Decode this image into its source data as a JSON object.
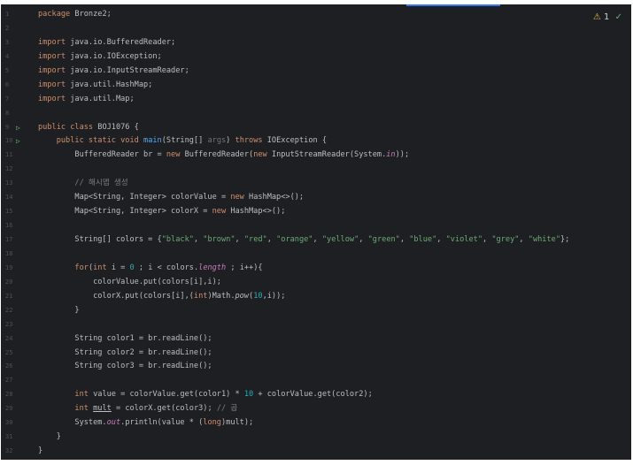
{
  "editor": {
    "status": {
      "warning_icon": "⚠",
      "warning_count": "1",
      "check_icon": "✓"
    },
    "lines": [
      {
        "n": "1",
        "t": [
          [
            "kw",
            "package "
          ],
          [
            "p",
            "Bronze2;"
          ]
        ]
      },
      {
        "n": "2",
        "t": []
      },
      {
        "n": "3",
        "t": [
          [
            "kw",
            "import "
          ],
          [
            "p",
            "java.io.BufferedReader;"
          ]
        ]
      },
      {
        "n": "4",
        "t": [
          [
            "kw",
            "import "
          ],
          [
            "p",
            "java.io.IOException;"
          ]
        ]
      },
      {
        "n": "5",
        "t": [
          [
            "kw",
            "import "
          ],
          [
            "p",
            "java.io.InputStreamReader;"
          ]
        ]
      },
      {
        "n": "6",
        "t": [
          [
            "kw",
            "import "
          ],
          [
            "p",
            "java.util.HashMap;"
          ]
        ]
      },
      {
        "n": "7",
        "t": [
          [
            "kw",
            "import "
          ],
          [
            "p",
            "java.util.Map;"
          ]
        ]
      },
      {
        "n": "8",
        "t": []
      },
      {
        "n": "9",
        "run": true,
        "t": [
          [
            "kw",
            "public class "
          ],
          [
            "p",
            "BOJ1076 {"
          ]
        ]
      },
      {
        "n": "10",
        "run": true,
        "t": [
          [
            "p",
            "    "
          ],
          [
            "kw",
            "public static void "
          ],
          [
            "fn",
            "main"
          ],
          [
            "p",
            "(String[] "
          ],
          [
            "par",
            "args"
          ],
          [
            "p",
            ") "
          ],
          [
            "kw",
            "throws "
          ],
          [
            "p",
            "IOException {"
          ]
        ]
      },
      {
        "n": "11",
        "t": [
          [
            "p",
            "        BufferedReader br = "
          ],
          [
            "kw",
            "new "
          ],
          [
            "p",
            "BufferedReader("
          ],
          [
            "kw",
            "new "
          ],
          [
            "p",
            "InputStreamReader(System."
          ],
          [
            "fldi",
            "in"
          ],
          [
            "p",
            "));"
          ]
        ]
      },
      {
        "n": "12",
        "t": []
      },
      {
        "n": "13",
        "t": [
          [
            "p",
            "        "
          ],
          [
            "cmt",
            "// 해시맵 생성"
          ]
        ]
      },
      {
        "n": "14",
        "t": [
          [
            "p",
            "        Map<String, Integer> colorValue = "
          ],
          [
            "kw",
            "new "
          ],
          [
            "p",
            "HashMap<>();"
          ]
        ]
      },
      {
        "n": "15",
        "t": [
          [
            "p",
            "        Map<String, Integer> colorX = "
          ],
          [
            "kw",
            "new "
          ],
          [
            "p",
            "HashMap<>();"
          ]
        ]
      },
      {
        "n": "16",
        "t": []
      },
      {
        "n": "17",
        "t": [
          [
            "p",
            "        String[] colors = {"
          ],
          [
            "str",
            "\"black\""
          ],
          [
            "p",
            ", "
          ],
          [
            "str",
            "\"brown\""
          ],
          [
            "p",
            ", "
          ],
          [
            "str",
            "\"red\""
          ],
          [
            "p",
            ", "
          ],
          [
            "str",
            "\"orange\""
          ],
          [
            "p",
            ", "
          ],
          [
            "str",
            "\"yellow\""
          ],
          [
            "p",
            ", "
          ],
          [
            "str",
            "\"green\""
          ],
          [
            "p",
            ", "
          ],
          [
            "str",
            "\"blue\""
          ],
          [
            "p",
            ", "
          ],
          [
            "str",
            "\"violet\""
          ],
          [
            "p",
            ", "
          ],
          [
            "str",
            "\"grey\""
          ],
          [
            "p",
            ", "
          ],
          [
            "str",
            "\"white\""
          ],
          [
            "p",
            "};"
          ]
        ]
      },
      {
        "n": "18",
        "t": []
      },
      {
        "n": "19",
        "t": [
          [
            "p",
            "        "
          ],
          [
            "kw",
            "for"
          ],
          [
            "p",
            "("
          ],
          [
            "kw",
            "int "
          ],
          [
            "p",
            "i = "
          ],
          [
            "num",
            "0"
          ],
          [
            "p",
            " ; i < colors."
          ],
          [
            "fld",
            "length"
          ],
          [
            "p",
            " ; i++){"
          ]
        ]
      },
      {
        "n": "20",
        "t": [
          [
            "p",
            "            colorValue.put(colors[i],i);"
          ]
        ]
      },
      {
        "n": "21",
        "t": [
          [
            "p",
            "            colorX.put(colors[i],("
          ],
          [
            "kw",
            "int"
          ],
          [
            "p",
            ")Math."
          ],
          [
            "i",
            "pow"
          ],
          [
            "p",
            "("
          ],
          [
            "num",
            "10"
          ],
          [
            "p",
            ",i));"
          ]
        ]
      },
      {
        "n": "22",
        "t": [
          [
            "p",
            "        }"
          ]
        ]
      },
      {
        "n": "23",
        "t": []
      },
      {
        "n": "24",
        "t": [
          [
            "p",
            "        String color1 = br.readLine();"
          ]
        ]
      },
      {
        "n": "25",
        "t": [
          [
            "p",
            "        String color2 = br.readLine();"
          ]
        ]
      },
      {
        "n": "26",
        "t": [
          [
            "p",
            "        String color3 = br.readLine();"
          ]
        ]
      },
      {
        "n": "27",
        "t": []
      },
      {
        "n": "28",
        "t": [
          [
            "p",
            "        "
          ],
          [
            "kw",
            "int "
          ],
          [
            "p",
            "value = colorValue.get(color1) * "
          ],
          [
            "num",
            "10"
          ],
          [
            "p",
            " + colorValue.get(color2);"
          ]
        ]
      },
      {
        "n": "29",
        "t": [
          [
            "p",
            "        "
          ],
          [
            "kw",
            "int "
          ],
          [
            "ul",
            "mult"
          ],
          [
            "p",
            " = colorX.get(color3); "
          ],
          [
            "cmt",
            "// 곱"
          ]
        ]
      },
      {
        "n": "30",
        "t": [
          [
            "p",
            "        System."
          ],
          [
            "fldi",
            "out"
          ],
          [
            "p",
            ".println(value * ("
          ],
          [
            "kw",
            "long"
          ],
          [
            "p",
            ")mult);"
          ]
        ]
      },
      {
        "n": "31",
        "t": [
          [
            "p",
            "    }"
          ]
        ]
      },
      {
        "n": "32",
        "t": [
          [
            "p",
            "}"
          ]
        ]
      }
    ]
  }
}
